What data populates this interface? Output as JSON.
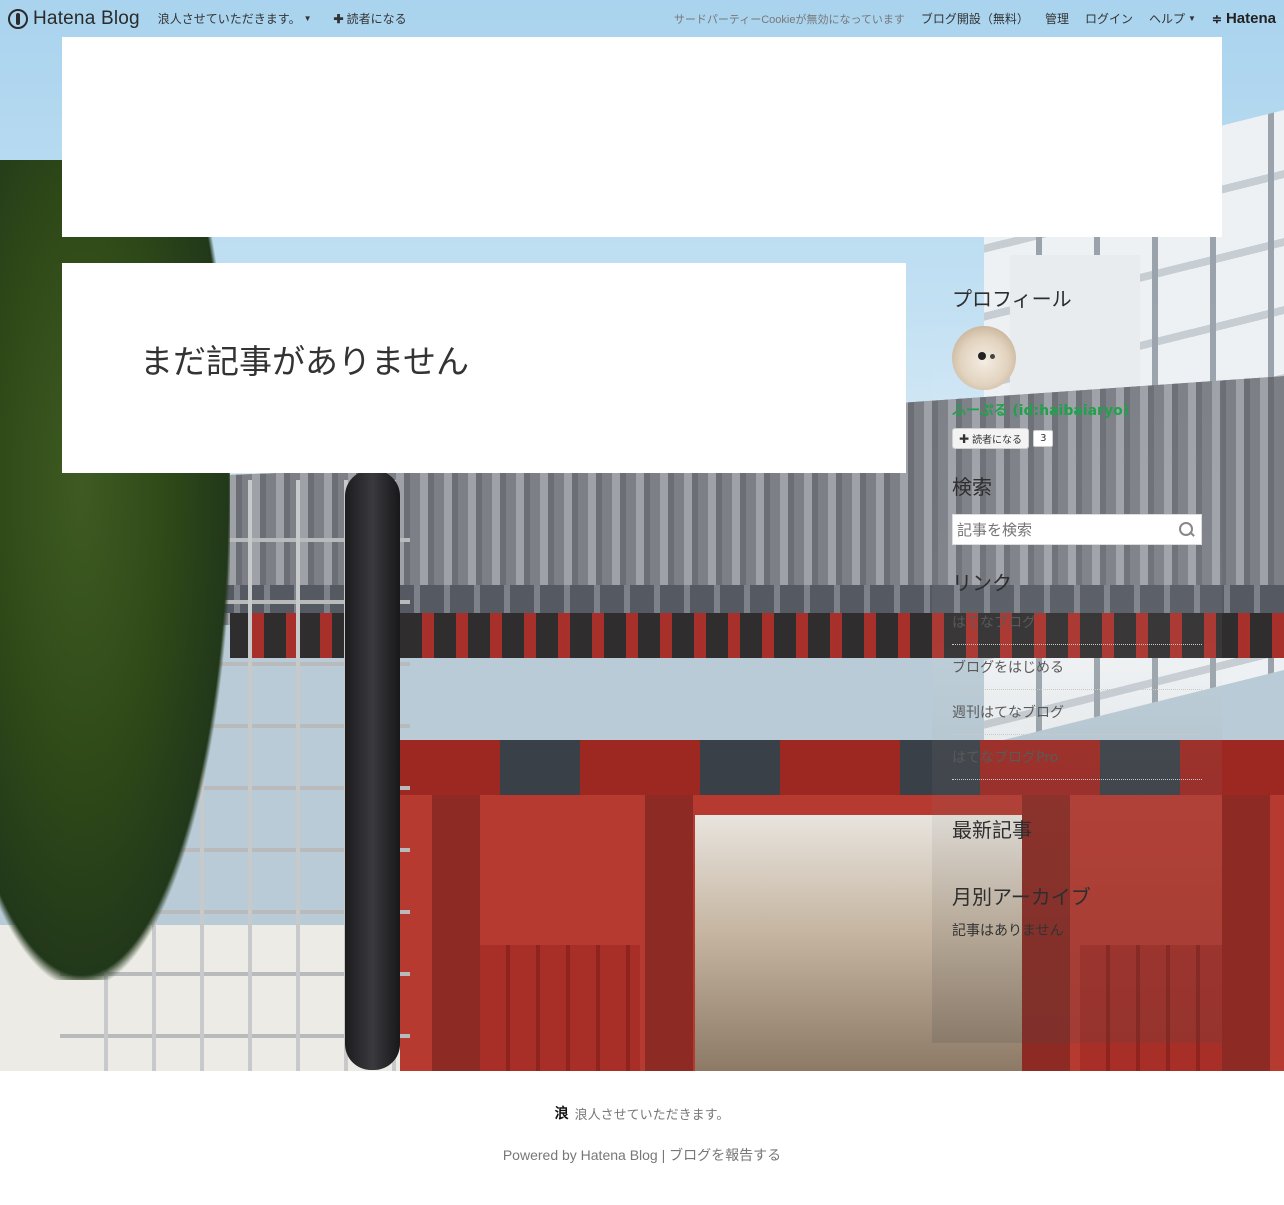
{
  "topbar": {
    "brand": "Hatena Blog",
    "blog_menu": "浪人させていただきます。",
    "subscribe": "読者になる",
    "cookie_notice": "サードパーティーCookieが無効になっています",
    "open_blog": "ブログ開設（無料）",
    "admin": "管理",
    "login": "ログイン",
    "help": "ヘルプ",
    "hatena": "Hatena"
  },
  "main": {
    "empty_message": "まだ記事がありません"
  },
  "sidebar": {
    "profile": {
      "title": "プロフィール",
      "name": "ふーぷる (id:haibaiaryo)",
      "subscribe_label": "読者になる",
      "subscriber_count": "3"
    },
    "search": {
      "title": "検索",
      "placeholder": "記事を検索"
    },
    "links": {
      "title": "リンク",
      "items": [
        "はてなブログ",
        "ブログをはじめる",
        "週刊はてなブログ",
        "はてなブログPro"
      ]
    },
    "recent": {
      "title": "最新記事"
    },
    "archive": {
      "title": "月別アーカイブ",
      "empty": "記事はありません"
    }
  },
  "footer": {
    "favicon": "浪",
    "blog_title": "浪人させていただきます。",
    "powered": "Powered by Hatena Blog",
    "separator": "|",
    "report": "ブログを報告する"
  },
  "colors": {
    "profile_name": "#1fa34a",
    "footer_text": "#777777"
  }
}
